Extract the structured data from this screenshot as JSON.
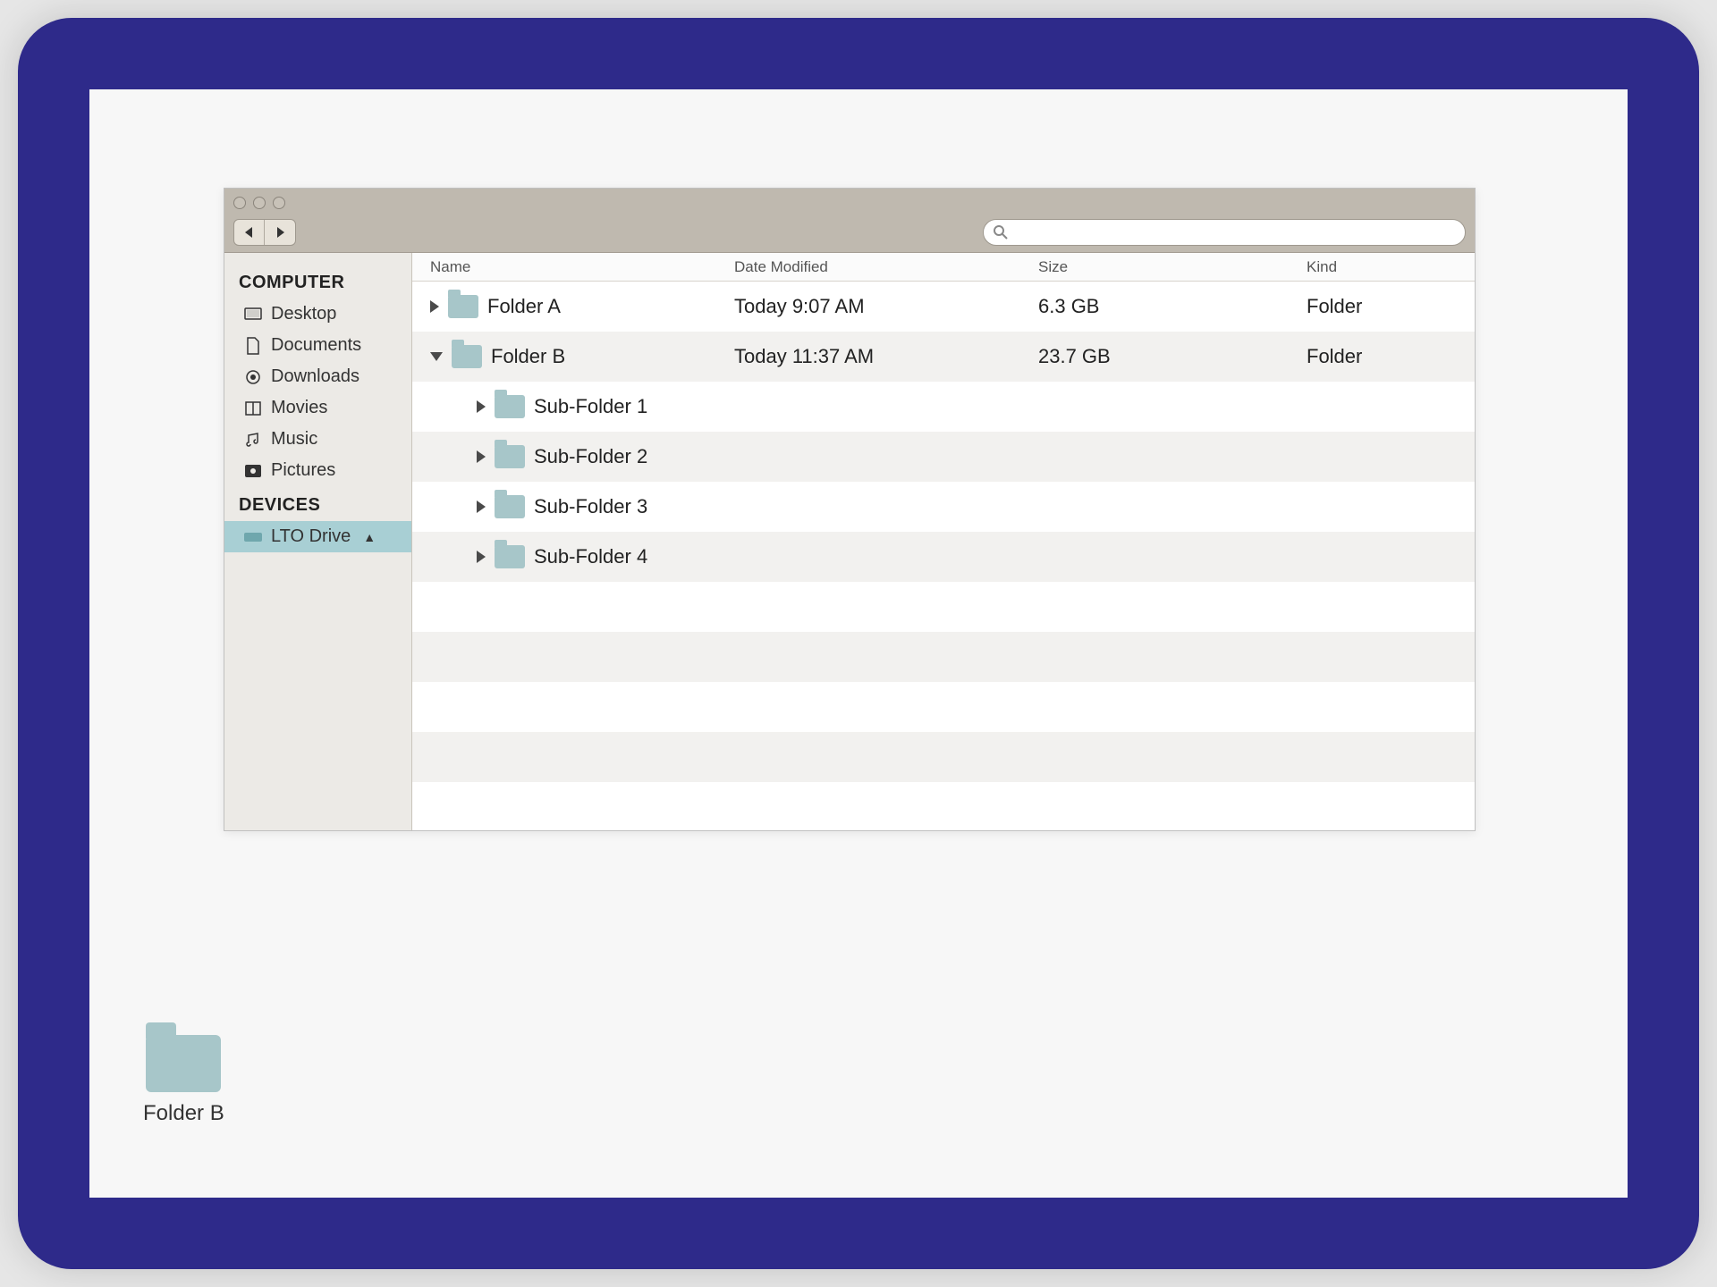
{
  "sidebar": {
    "section_computer": "COMPUTER",
    "section_devices": "DEVICES",
    "items": [
      {
        "label": "Desktop",
        "icon": "desktop-icon"
      },
      {
        "label": "Documents",
        "icon": "document-icon"
      },
      {
        "label": "Downloads",
        "icon": "downloads-icon"
      },
      {
        "label": "Movies",
        "icon": "movies-icon"
      },
      {
        "label": "Music",
        "icon": "music-icon"
      },
      {
        "label": "Pictures",
        "icon": "pictures-icon"
      }
    ],
    "devices": [
      {
        "label": "LTO Drive",
        "icon": "drive-icon",
        "selected": true
      }
    ]
  },
  "columns": {
    "name": "Name",
    "date": "Date Modified",
    "size": "Size",
    "kind": "Kind"
  },
  "rows": [
    {
      "level": 1,
      "expanded": false,
      "name": "Folder A",
      "date": "Today 9:07 AM",
      "size": "6.3 GB",
      "kind": "Folder"
    },
    {
      "level": 1,
      "expanded": true,
      "name": "Folder B",
      "date": "Today 11:37 AM",
      "size": "23.7 GB",
      "kind": "Folder"
    },
    {
      "level": 2,
      "expanded": false,
      "name": "Sub-Folder 1",
      "date": "",
      "size": "",
      "kind": ""
    },
    {
      "level": 2,
      "expanded": false,
      "name": "Sub-Folder 2",
      "date": "",
      "size": "",
      "kind": ""
    },
    {
      "level": 2,
      "expanded": false,
      "name": "Sub-Folder 3",
      "date": "",
      "size": "",
      "kind": ""
    },
    {
      "level": 2,
      "expanded": false,
      "name": "Sub-Folder 4",
      "date": "",
      "size": "",
      "kind": ""
    }
  ],
  "search": {
    "placeholder": ""
  },
  "desktop_item": {
    "label": "Folder B"
  },
  "colors": {
    "frame": "#2e2a8a",
    "folder": "#a7c6c9",
    "titlebar": "#bfb9af",
    "sidebar_selected": "#a8cfd4"
  }
}
